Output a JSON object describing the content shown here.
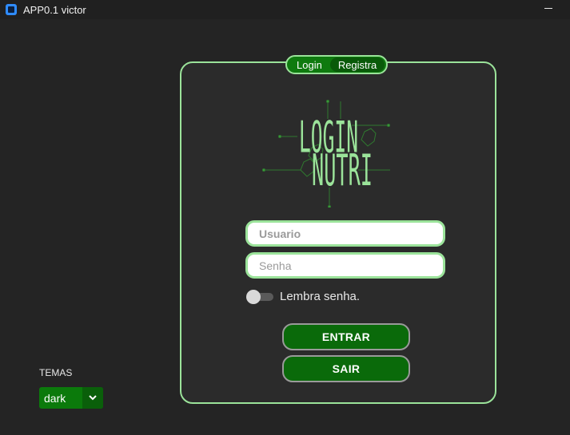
{
  "window": {
    "title": "APP0.1 victor",
    "icon": "app-window-icon",
    "controls": [
      "minimize-icon"
    ]
  },
  "tabs": [
    {
      "label": "Login",
      "active": false
    },
    {
      "label": "Registra",
      "active": true
    }
  ],
  "logo": {
    "line1": "LOGIN",
    "line2": "NUTRI",
    "color": "#9be39a"
  },
  "form": {
    "username_placeholder": "Usuario",
    "username_value": "",
    "password_placeholder": "Senha",
    "password_value": "",
    "remember_label": "Lembra senha.",
    "remember_checked": false
  },
  "buttons": {
    "enter_label": "ENTRAR",
    "exit_label": "SAIR"
  },
  "theme": {
    "label": "TEMAS",
    "selected": "dark"
  },
  "colors": {
    "background": "#242424",
    "panel": "#2b2b2b",
    "accent_border": "#9be39a",
    "button_green": "#0a6a0a"
  }
}
